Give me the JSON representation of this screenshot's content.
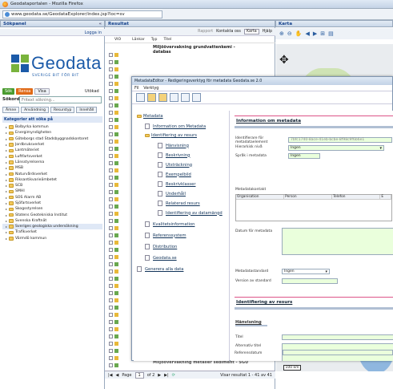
{
  "window": {
    "title": "Geodataportalen - Mozilla Firefox",
    "url": "www.geodata.se/GeodataExplorer/index.jsp?loc=sv"
  },
  "left": {
    "header": "Sökpanel",
    "login": "Logga in",
    "logo_word": "Geodata",
    "logo_sub": "SVERIGE BIT FÖR BIT",
    "buttons": [
      "Sök",
      "Rensa",
      "Visa",
      "Utökad"
    ],
    "search_label": "Sökord:",
    "search_placeholder": "Fritext sökning...",
    "tabs": [
      "Ämne",
      "Användning",
      "Resurstyp",
      "Innehåll"
    ],
    "categories_header": "Kategorier att söka på",
    "tree": [
      "Bolbyrka kommun",
      "Energimyndigheten",
      "Göteborgs stad Stadsbyggnadskontoret",
      "Jordbruksverket",
      "Lantmäteriet",
      "Luftfartsverket",
      "Länsstyrelserna",
      "MSB",
      "Naturvårdsverket",
      "Riksantikvarieämbetet",
      "SCB",
      "SMHI",
      "SOS Alarm AB",
      "Sjöfartsverket",
      "Skogsstyrelsen",
      "Statens Geotekniska Institut",
      "Svenska Kraftnät",
      "Sveriges geologiska undersökning",
      "Trafikverket",
      "Värmdö kommun"
    ],
    "selected_index": 17
  },
  "mid": {
    "header": "Resultat",
    "toolbar": [
      "Rapport",
      "Kontakta oss",
      "Karta",
      "Hjälp"
    ],
    "columns": [
      "VIO",
      "Länkar",
      "Typ",
      "Titel"
    ],
    "first_title": "Miljöövervakning grundvattenkemi - databas",
    "last_title": "Miljöövervakning metaller sediment - SGU",
    "pager_page_label": "Page",
    "pager_page": "1",
    "pager_of": "of 2",
    "pager_status": "Visar resultat 1 - 41 av 41"
  },
  "right": {
    "header": "Karta",
    "scale": "100 km"
  },
  "dialog": {
    "title": "MetadataEditor - Redigeringsverktyg för metadata Geodata.se 2.0",
    "menu": [
      "Fil",
      "Verktyg"
    ],
    "nav": [
      "Metadata",
      "Information om Metadata",
      "Identifiering av resurs",
      "Hänvisning",
      "Beskrivning",
      "Utsträckning",
      "Exempelbild",
      "Beskrivklasser",
      "Underhåll",
      "Relaterad resurs",
      "Identifiering av datamängd",
      "Kvalitetsinformation",
      "Referenssystem",
      "Distribution",
      "Geodata.se",
      "Generera alla data"
    ],
    "section1": "Information om metadata",
    "identifier_label": "Identifierare för metadataelement",
    "identifier_value": "7bfc1740-8ace-41eb-bcbe-8f98c9f6b6e1",
    "hierarchy_label": "Hierarkisk nivå",
    "hierarchy_value": "Ingen",
    "language_label": "Språk i metadata",
    "language_value": "Ingen",
    "contact_label": "Metadatakontakt",
    "contact_cols": [
      "Organisation",
      "Person",
      "Telefon",
      "E"
    ],
    "date_label": "Datum för metadata",
    "standard_label": "Metadatastandard",
    "standard_value": "Ingen",
    "version_label": "Version av standard",
    "section2": "Identifiering av resurs",
    "subsection": "Hänvisning",
    "title_label": "Titel",
    "alt_title_label": "Alternativ titel",
    "ref_date_label": "Referensdatum"
  }
}
